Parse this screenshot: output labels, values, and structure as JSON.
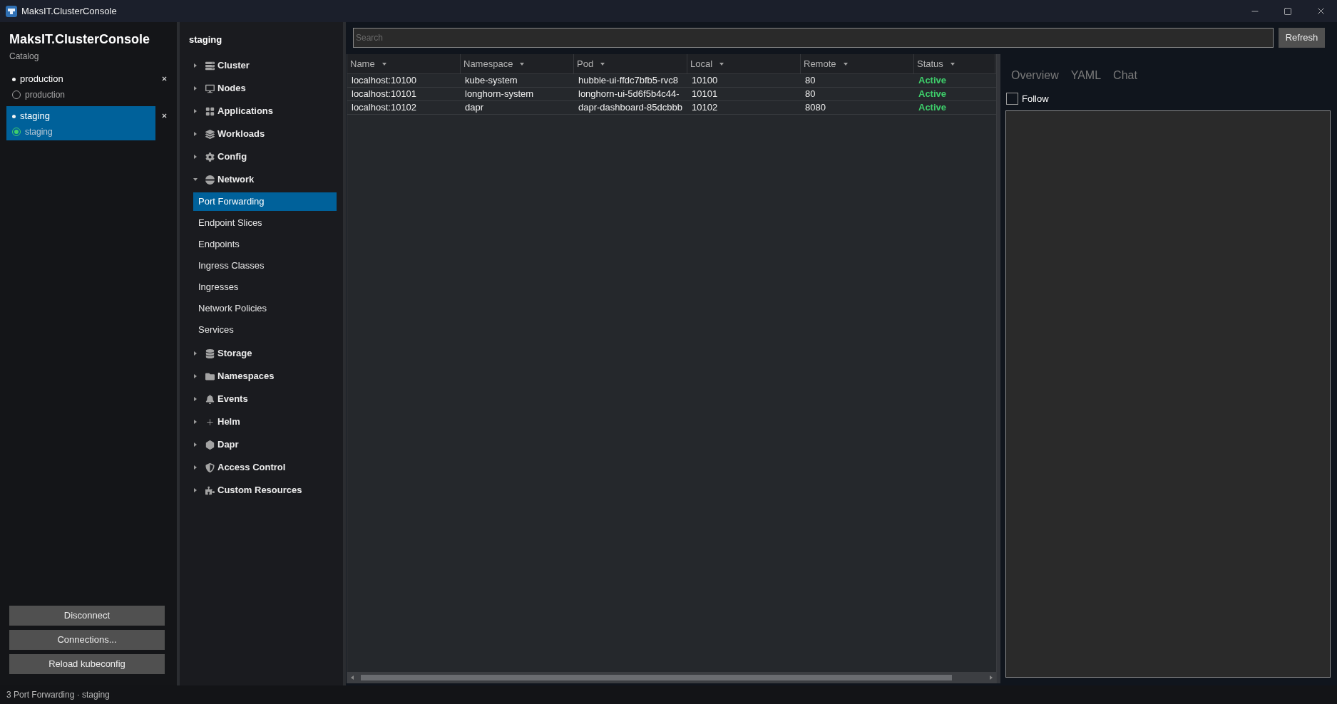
{
  "window": {
    "title": "MaksIT.ClusterConsole"
  },
  "sidebar": {
    "app_title": "MaksIT.ClusterConsole",
    "subtitle": "Catalog",
    "connections": [
      {
        "name": "production",
        "context": "production",
        "selected": false,
        "checked": false
      },
      {
        "name": "staging",
        "context": "staging",
        "selected": true,
        "checked": true
      }
    ],
    "buttons": [
      "Disconnect",
      "Connections...",
      "Reload kubeconfig"
    ]
  },
  "navigation": {
    "title": "staging",
    "items": [
      {
        "label": "Cluster",
        "expanded": false,
        "selected": false
      },
      {
        "label": "Nodes",
        "expanded": false,
        "selected": false
      },
      {
        "label": "Applications",
        "expanded": false,
        "selected": false
      },
      {
        "label": "Workloads",
        "expanded": false,
        "selected": false
      },
      {
        "label": "Config",
        "expanded": false,
        "selected": false
      },
      {
        "label": "Network",
        "expanded": true,
        "selected": false,
        "children": [
          {
            "label": "Port Forwarding",
            "selected": true
          },
          {
            "label": "Endpoint Slices",
            "selected": false
          },
          {
            "label": "Endpoints",
            "selected": false
          },
          {
            "label": "Ingress Classes",
            "selected": false
          },
          {
            "label": "Ingresses",
            "selected": false
          },
          {
            "label": "Network Policies",
            "selected": false
          },
          {
            "label": "Services",
            "selected": false
          }
        ]
      },
      {
        "label": "Storage",
        "expanded": false,
        "selected": false
      },
      {
        "label": "Namespaces",
        "expanded": false,
        "selected": false
      },
      {
        "label": "Events",
        "expanded": false,
        "selected": false
      },
      {
        "label": "Helm",
        "expanded": false,
        "selected": false
      },
      {
        "label": "Dapr",
        "expanded": false,
        "selected": false
      },
      {
        "label": "Access Control",
        "expanded": false,
        "selected": false
      },
      {
        "label": "Custom Resources",
        "expanded": false,
        "selected": false
      }
    ]
  },
  "toolbar": {
    "search": {
      "placeholder": "Search"
    },
    "refresh_button": "Refresh"
  },
  "table": {
    "columns": [
      {
        "label": "Name",
        "kind": "text"
      },
      {
        "label": "Namespace",
        "kind": "text"
      },
      {
        "label": "Pod",
        "kind": "text"
      },
      {
        "label": "Local",
        "kind": "text"
      },
      {
        "label": "Remote",
        "kind": "text"
      },
      {
        "label": "Status",
        "kind": "status"
      }
    ],
    "rows": [
      [
        "localhost:10100",
        "kube-system",
        "hubble-ui-ffdc7bfb5-rvc8",
        "10100",
        "80",
        "Active"
      ],
      [
        "localhost:10101",
        "longhorn-system",
        "longhorn-ui-5d6f5b4c44-",
        "10101",
        "80",
        "Active"
      ],
      [
        "localhost:10102",
        "dapr",
        "dapr-dashboard-85dcbbb",
        "10102",
        "8080",
        "Active"
      ]
    ]
  },
  "details": {
    "tabs": [
      {
        "label": "Overview",
        "selected": false
      },
      {
        "label": "YAML",
        "selected": false
      },
      {
        "label": "Chat",
        "selected": false
      }
    ],
    "follow": {
      "label": "Follow",
      "checked": false
    }
  },
  "status_bar": "3 Port Forwarding · staging"
}
